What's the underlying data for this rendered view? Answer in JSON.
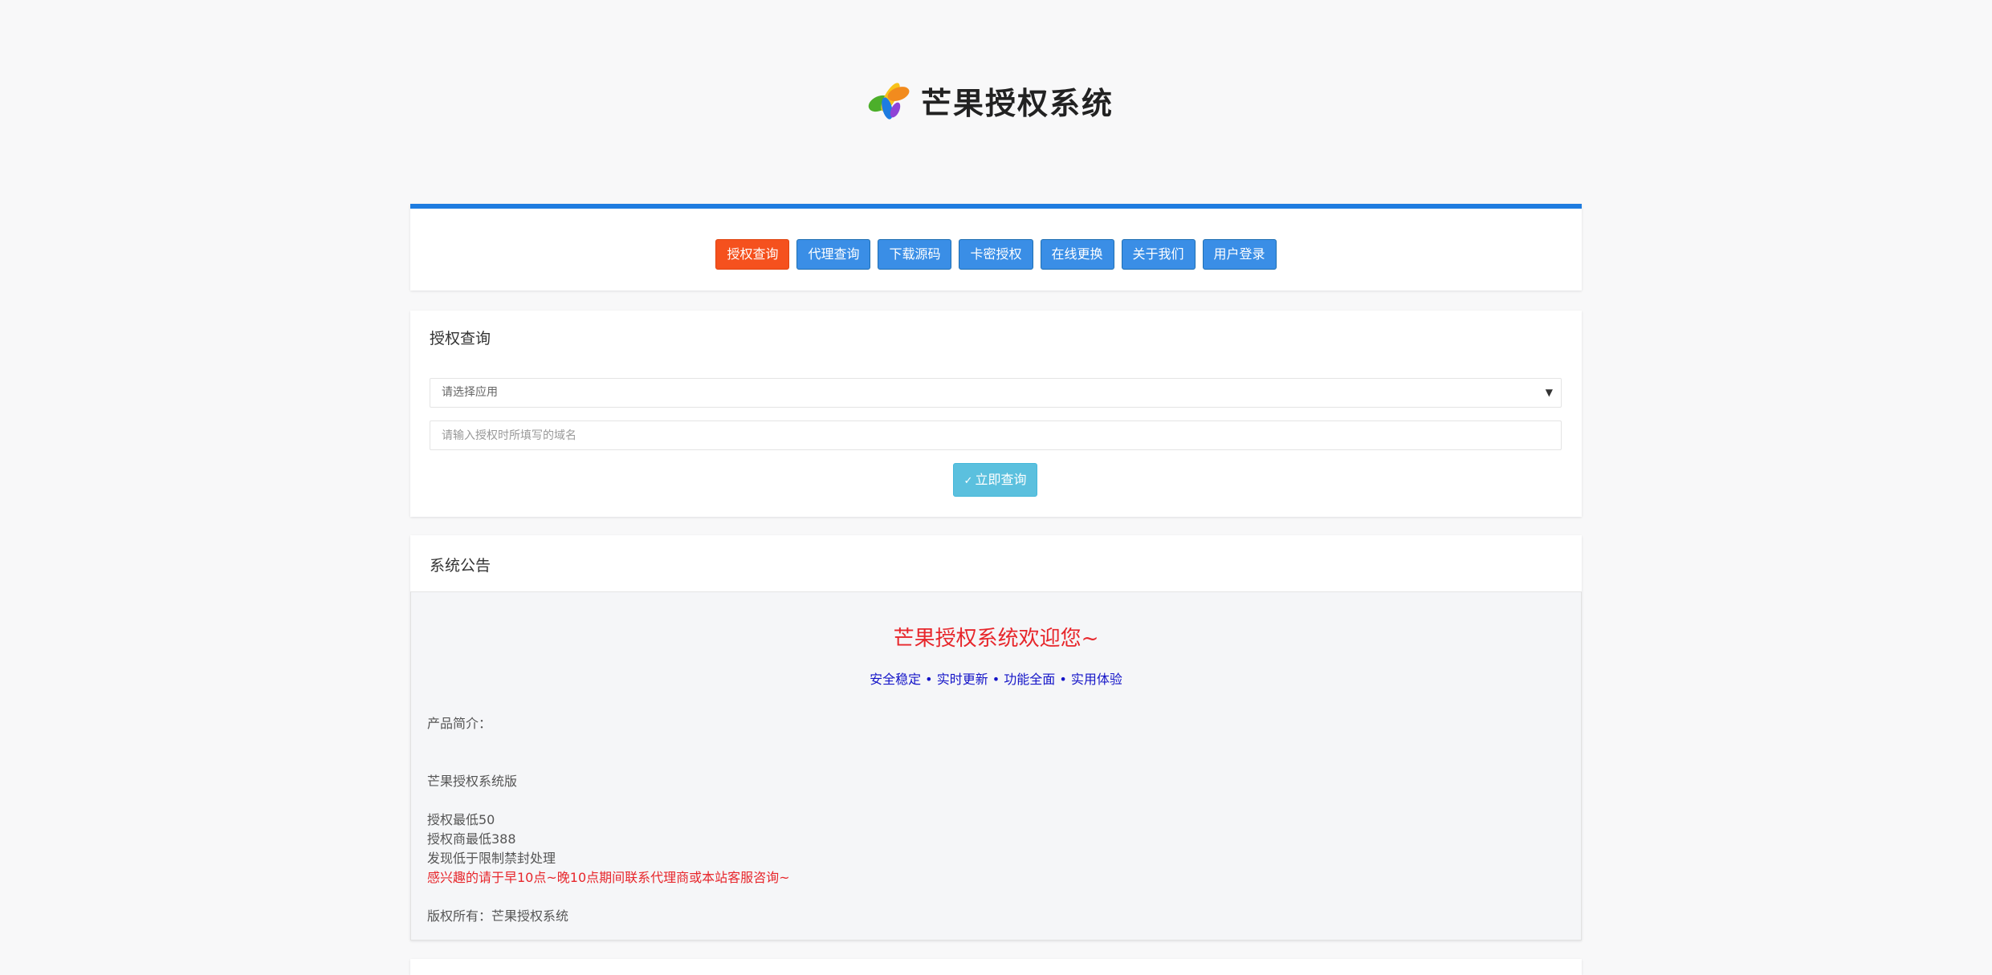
{
  "logo": {
    "text": "芒果授权系统"
  },
  "nav": {
    "items": [
      {
        "label": "授权查询",
        "active": true
      },
      {
        "label": "代理查询",
        "active": false
      },
      {
        "label": "下载源码",
        "active": false
      },
      {
        "label": "卡密授权",
        "active": false
      },
      {
        "label": "在线更换",
        "active": false
      },
      {
        "label": "关于我们",
        "active": false
      },
      {
        "label": "用户登录",
        "active": false
      }
    ]
  },
  "query": {
    "title": "授权查询",
    "app_select_value": "请选择应用",
    "domain_placeholder": "请输入授权时所填写的域名",
    "submit_icon": "check-circle-icon",
    "submit_label": "立即查询"
  },
  "notice": {
    "title": "系统公告",
    "welcome": "芒果授权系统欢迎您~",
    "slogan": "安全稳定 • 实时更新 • 功能全面 • 实用体验",
    "intro_label": "产品简介：",
    "version": "芒果授权系统版",
    "price_auth": "授权最低50",
    "price_agent": "授权商最低388",
    "ban_notice": "发现低于限制禁封处理",
    "contact": "感兴趣的请于早10点~晚10点期间联系代理商或本站客服咨询~",
    "copyright": "版权所有：芒果授权系统"
  },
  "colors": {
    "accent_bar": "#1e7ce0",
    "nav_button": "#3a8ee6",
    "nav_button_active": "#f5511e",
    "submit_button": "#5bc0de",
    "welcome_text": "#e7262b",
    "slogan_text": "#1515c8"
  }
}
